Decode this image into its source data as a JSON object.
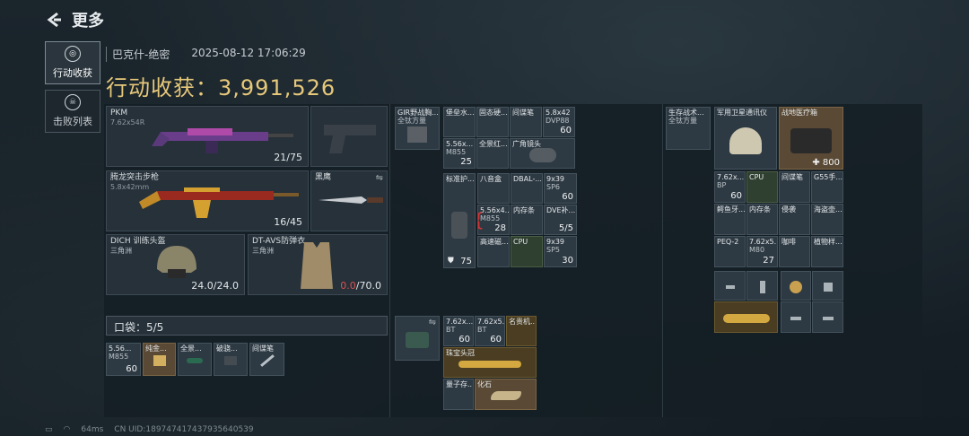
{
  "header": {
    "title": "更多"
  },
  "tabs": [
    {
      "label": "行动收获"
    },
    {
      "label": "击败列表"
    }
  ],
  "meta": {
    "map": "巴克什-绝密",
    "datetime": "2025-08-12 17:06:29"
  },
  "harvest": {
    "label": "行动收获：",
    "value": "3,991,526"
  },
  "gear": {
    "primary": {
      "name": "PKM",
      "caliber": "7.62x54R",
      "ammo": "21/75"
    },
    "secondary": {
      "name": "腾龙突击步枪",
      "caliber": "5.8x42mm",
      "ammo": "16/45"
    },
    "melee": {
      "name": "黑鹰"
    },
    "helmet": {
      "name": "DICH 训练头盔",
      "origin": "三角洲",
      "durability": "24.0/24.0"
    },
    "armor": {
      "name": "DT-AVS防弹衣",
      "origin": "三角洲",
      "durability_current": "0.0",
      "durability_max": "/70.0"
    }
  },
  "pocket": {
    "label": "口袋：5/5"
  },
  "pocket_items": [
    {
      "t": "5.56...",
      "t2": "M855",
      "n": "60"
    },
    {
      "t": "纯金...",
      "t2": "",
      "n": ""
    },
    {
      "t": "全景...",
      "t2": "",
      "n": ""
    },
    {
      "t": "破骁...",
      "t2": "",
      "n": ""
    },
    {
      "t": "间谍笔",
      "t2": "",
      "n": ""
    }
  ],
  "rig": {
    "title": "GIR野战胸...",
    "sub": "全钛方量",
    "items": [
      {
        "t": "堡垒水...",
        "t2": "",
        "n": ""
      },
      {
        "t": "固态硬...",
        "t2": "",
        "n": ""
      },
      {
        "t": "间谍笔",
        "t2": "",
        "n": ""
      },
      {
        "t": "5.8x42",
        "t2": "DVP88",
        "n": "60"
      },
      {
        "t": "5.56x...",
        "t2": "M855",
        "n": "25"
      },
      {
        "t": "全景红...",
        "t2": "",
        "n": ""
      },
      {
        "t": "广角镜头",
        "t2": "",
        "n": ""
      }
    ]
  },
  "backpack": {
    "title": "标准护...",
    "count": "75",
    "items": [
      {
        "t": "八音盒",
        "t2": "",
        "n": ""
      },
      {
        "t": "DBAL-...",
        "t2": "",
        "n": ""
      },
      {
        "t": "9x39",
        "t2": "SP6",
        "n": "60"
      },
      {
        "t": "5.56x4...",
        "t2": "M855",
        "n": "28"
      },
      {
        "t": "内存条",
        "t2": "",
        "n": ""
      },
      {
        "t": "DVE补...",
        "t2": "",
        "n": "5/5"
      },
      {
        "t": "高速磁...",
        "t2": "",
        "n": ""
      },
      {
        "t": "CPU",
        "t2": "",
        "n": ""
      },
      {
        "t": "9x39",
        "t2": "SP5",
        "n": "30"
      }
    ]
  },
  "case": {
    "items": [
      {
        "t": "7.62x...",
        "t2": "BT",
        "n": "60"
      },
      {
        "t": "7.62x5...",
        "t2": "BT",
        "n": "60"
      },
      {
        "t": "名贵机...",
        "t2": "",
        "n": ""
      },
      {
        "t": "珠宝头冠",
        "t2": "",
        "n": ""
      },
      {
        "t": "量子存...",
        "t2": "",
        "n": ""
      },
      {
        "t": "化石",
        "t2": "",
        "n": ""
      }
    ]
  },
  "right": {
    "vest": {
      "t": "生存战术...",
      "t2": "全钛方量"
    },
    "radio": {
      "t": "军用卫星通讯仪"
    },
    "medkit": {
      "t": "战地医疗箱",
      "n": "800"
    },
    "items": [
      {
        "t": "7.62x...",
        "t2": "BP",
        "n": "60"
      },
      {
        "t": "CPU",
        "t2": "",
        "n": ""
      },
      {
        "t": "间谍笔",
        "t2": "",
        "n": ""
      },
      {
        "t": "G55手...",
        "t2": "",
        "n": ""
      },
      {
        "t": "鳄鱼牙...",
        "t2": "",
        "n": ""
      },
      {
        "t": "内存条",
        "t2": "",
        "n": ""
      },
      {
        "t": "侵袭",
        "t2": "",
        "n": ""
      },
      {
        "t": "海盗壶...",
        "t2": "",
        "n": ""
      },
      {
        "t": "PEQ-2",
        "t2": "",
        "n": ""
      },
      {
        "t": "7.62x5...",
        "t2": "M80",
        "n": "27"
      },
      {
        "t": "咖啡",
        "t2": "",
        "n": ""
      },
      {
        "t": "植物样...",
        "t2": "",
        "n": ""
      }
    ]
  },
  "footer": {
    "ping": "64ms",
    "uid": "CN UID:1897474174379356405​39"
  }
}
